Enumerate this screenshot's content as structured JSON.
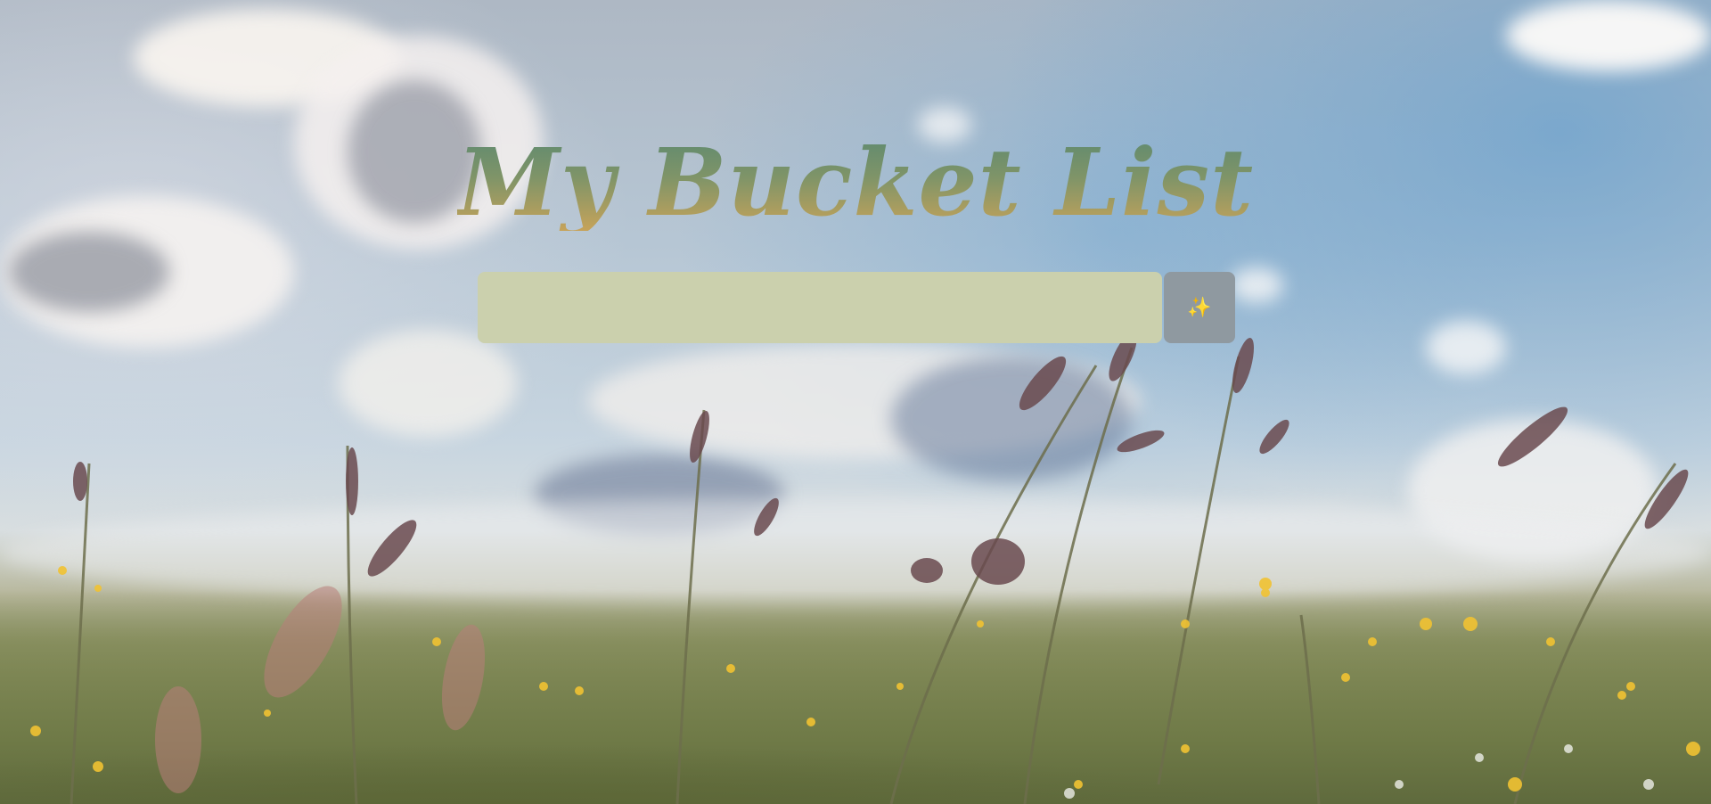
{
  "header": {
    "title": "My Bucket List"
  },
  "form": {
    "input_value": "",
    "input_placeholder": "",
    "add_button_icon": "sparkles-icon",
    "add_button_glyph": "✨"
  },
  "colors": {
    "title_gradient_top": "#5e8a70",
    "title_gradient_bottom": "#c6a35a",
    "input_background": "#cbd0ad",
    "button_background": "#8f99a0",
    "button_glyph": "#f0c040"
  }
}
